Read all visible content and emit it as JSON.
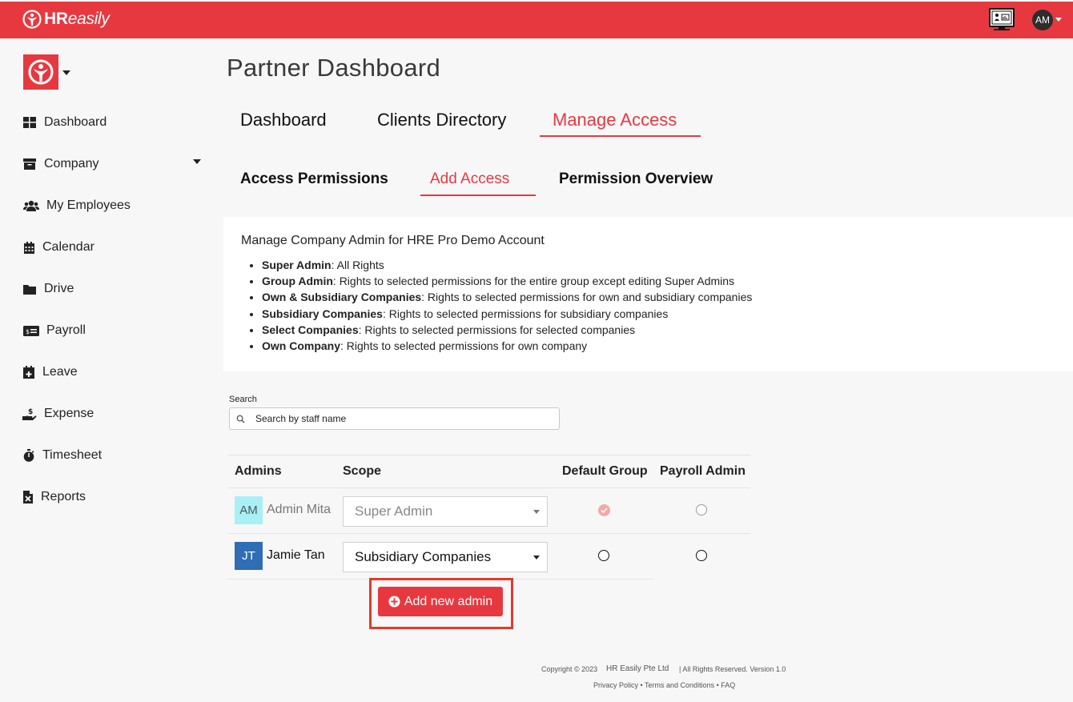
{
  "header": {
    "brand_bold": "HR",
    "brand_italic": "easily",
    "user_initials": "AM"
  },
  "sidebar": {
    "items": [
      {
        "label": "Dashboard",
        "icon": "dashboard-grid-icon"
      },
      {
        "label": "Company",
        "icon": "archive-box-icon"
      },
      {
        "label": "My Employees",
        "icon": "users-icon"
      },
      {
        "label": "Calendar",
        "icon": "calendar-icon"
      },
      {
        "label": "Drive",
        "icon": "folder-icon"
      },
      {
        "label": "Payroll",
        "icon": "money-bill-icon"
      },
      {
        "label": "Leave",
        "icon": "calendar-plus-icon"
      },
      {
        "label": "Expense",
        "icon": "hand-holding-dollar-icon"
      },
      {
        "label": "Timesheet",
        "icon": "stopwatch-icon"
      },
      {
        "label": "Reports",
        "icon": "file-excel-icon"
      }
    ]
  },
  "main": {
    "title": "Partner Dashboard",
    "tabs": [
      {
        "label": "Dashboard",
        "active": false
      },
      {
        "label": "Clients Directory",
        "active": false
      },
      {
        "label": "Manage Access",
        "active": true
      }
    ],
    "subtabs": [
      {
        "label": "Access Permissions",
        "active": false
      },
      {
        "label": "Add Access",
        "active": true
      },
      {
        "label": "Permission Overview",
        "active": false
      }
    ]
  },
  "info": {
    "title": "Manage Company Admin for HRE Pro Demo Account",
    "items": [
      {
        "term": "Super Admin",
        "desc": ": All Rights"
      },
      {
        "term": "Group Admin",
        "desc": ": Rights to selected permissions for the entire group except editing Super Admins"
      },
      {
        "term": "Own & Subsidiary Companies",
        "desc": ": Rights to selected permissions for own and subsidiary companies"
      },
      {
        "term": "Subsidiary Companies",
        "desc": ": Rights to selected permissions for subsidiary companies"
      },
      {
        "term": "Select Companies",
        "desc": ": Rights to selected permissions for selected companies"
      },
      {
        "term": "Own Company",
        "desc": ": Rights to selected permissions for own company"
      }
    ]
  },
  "search": {
    "label": "Search",
    "placeholder": "Search by staff name"
  },
  "table": {
    "headers": [
      "Admins",
      "Scope",
      "Default Group",
      "Payroll Admin"
    ],
    "rows": [
      {
        "initials": "AM",
        "name": "Admin Mita",
        "scope": "Super Admin",
        "default_group": true,
        "payroll_admin": false,
        "disabled": true,
        "avatar_color": "#a8f0f5"
      },
      {
        "initials": "JT",
        "name": "Jamie Tan",
        "scope": "Subsidiary Companies",
        "default_group": false,
        "payroll_admin": false,
        "disabled": false,
        "avatar_color": "#2f6db5"
      }
    ]
  },
  "add_button": {
    "label": "Add new admin"
  },
  "footer": {
    "copyright": "Copyright © 2023",
    "company": "HR Easily Pte Ltd",
    "rights": "| All Rights Reserved. Version 1.0",
    "privacy": "Privacy Policy",
    "terms": "Terms and Conditions",
    "faq": "FAQ",
    "separator": "•"
  },
  "colors": {
    "brand_red": "#e8383f",
    "highlight": "#e23a2c"
  }
}
